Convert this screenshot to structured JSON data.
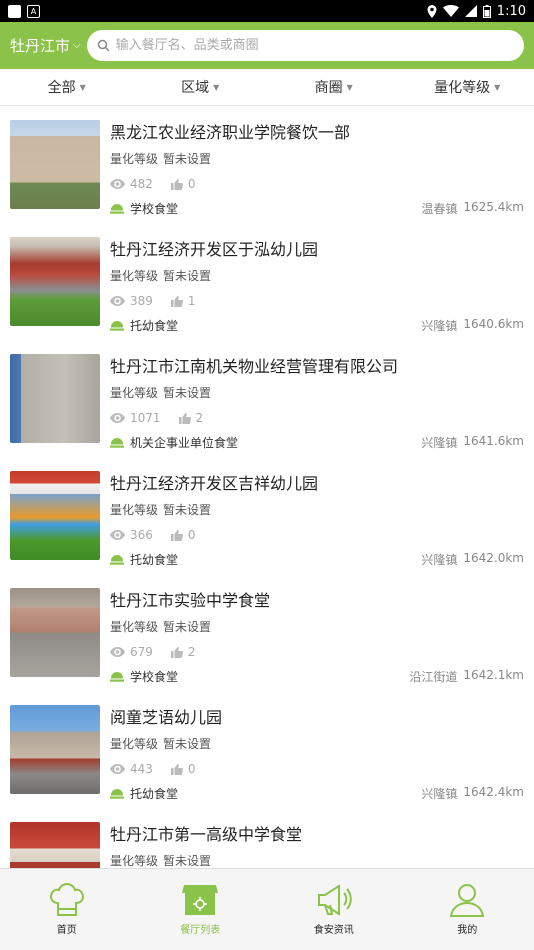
{
  "status_bar": {
    "time": "1:10"
  },
  "header": {
    "city": "牡丹江市",
    "search_placeholder": "输入餐厅名、品类或商圈"
  },
  "filters": [
    {
      "label": "全部"
    },
    {
      "label": "区域"
    },
    {
      "label": "商圈"
    },
    {
      "label": "量化等级"
    }
  ],
  "items": [
    {
      "name": "黑龙江农业经济职业学院餐饮一部",
      "grade_label": "量化等级",
      "grade_value": "暂未设置",
      "views": "482",
      "likes": "0",
      "category": "学校食堂",
      "town": "温春镇",
      "distance": "1625.4km"
    },
    {
      "name": "牡丹江经济开发区于泓幼儿园",
      "grade_label": "量化等级",
      "grade_value": "暂未设置",
      "views": "389",
      "likes": "1",
      "category": "托幼食堂",
      "town": "兴隆镇",
      "distance": "1640.6km"
    },
    {
      "name": "牡丹江市江南机关物业经营管理有限公司",
      "grade_label": "量化等级",
      "grade_value": "暂未设置",
      "views": "1071",
      "likes": "2",
      "category": "机关企事业单位食堂",
      "town": "兴隆镇",
      "distance": "1641.6km"
    },
    {
      "name": "牡丹江经济开发区吉祥幼儿园",
      "grade_label": "量化等级",
      "grade_value": "暂未设置",
      "views": "366",
      "likes": "0",
      "category": "托幼食堂",
      "town": "兴隆镇",
      "distance": "1642.0km"
    },
    {
      "name": "牡丹江市实验中学食堂",
      "grade_label": "量化等级",
      "grade_value": "暂未设置",
      "views": "679",
      "likes": "2",
      "category": "学校食堂",
      "town": "沿江街道",
      "distance": "1642.1km"
    },
    {
      "name": "阅童芝语幼儿园",
      "grade_label": "量化等级",
      "grade_value": "暂未设置",
      "views": "443",
      "likes": "0",
      "category": "托幼食堂",
      "town": "兴隆镇",
      "distance": "1642.4km"
    },
    {
      "name": "牡丹江市第一高级中学食堂",
      "grade_label": "量化等级",
      "grade_value": "暂未设置"
    }
  ],
  "tabs": [
    {
      "label": "首页",
      "icon": "chef-hat-icon"
    },
    {
      "label": "餐厅列表",
      "icon": "store-icon"
    },
    {
      "label": "食安资讯",
      "icon": "megaphone-icon"
    },
    {
      "label": "我的",
      "icon": "user-icon"
    }
  ],
  "colors": {
    "brand": "#8bc34a",
    "active_tab": "#8bc34a"
  }
}
